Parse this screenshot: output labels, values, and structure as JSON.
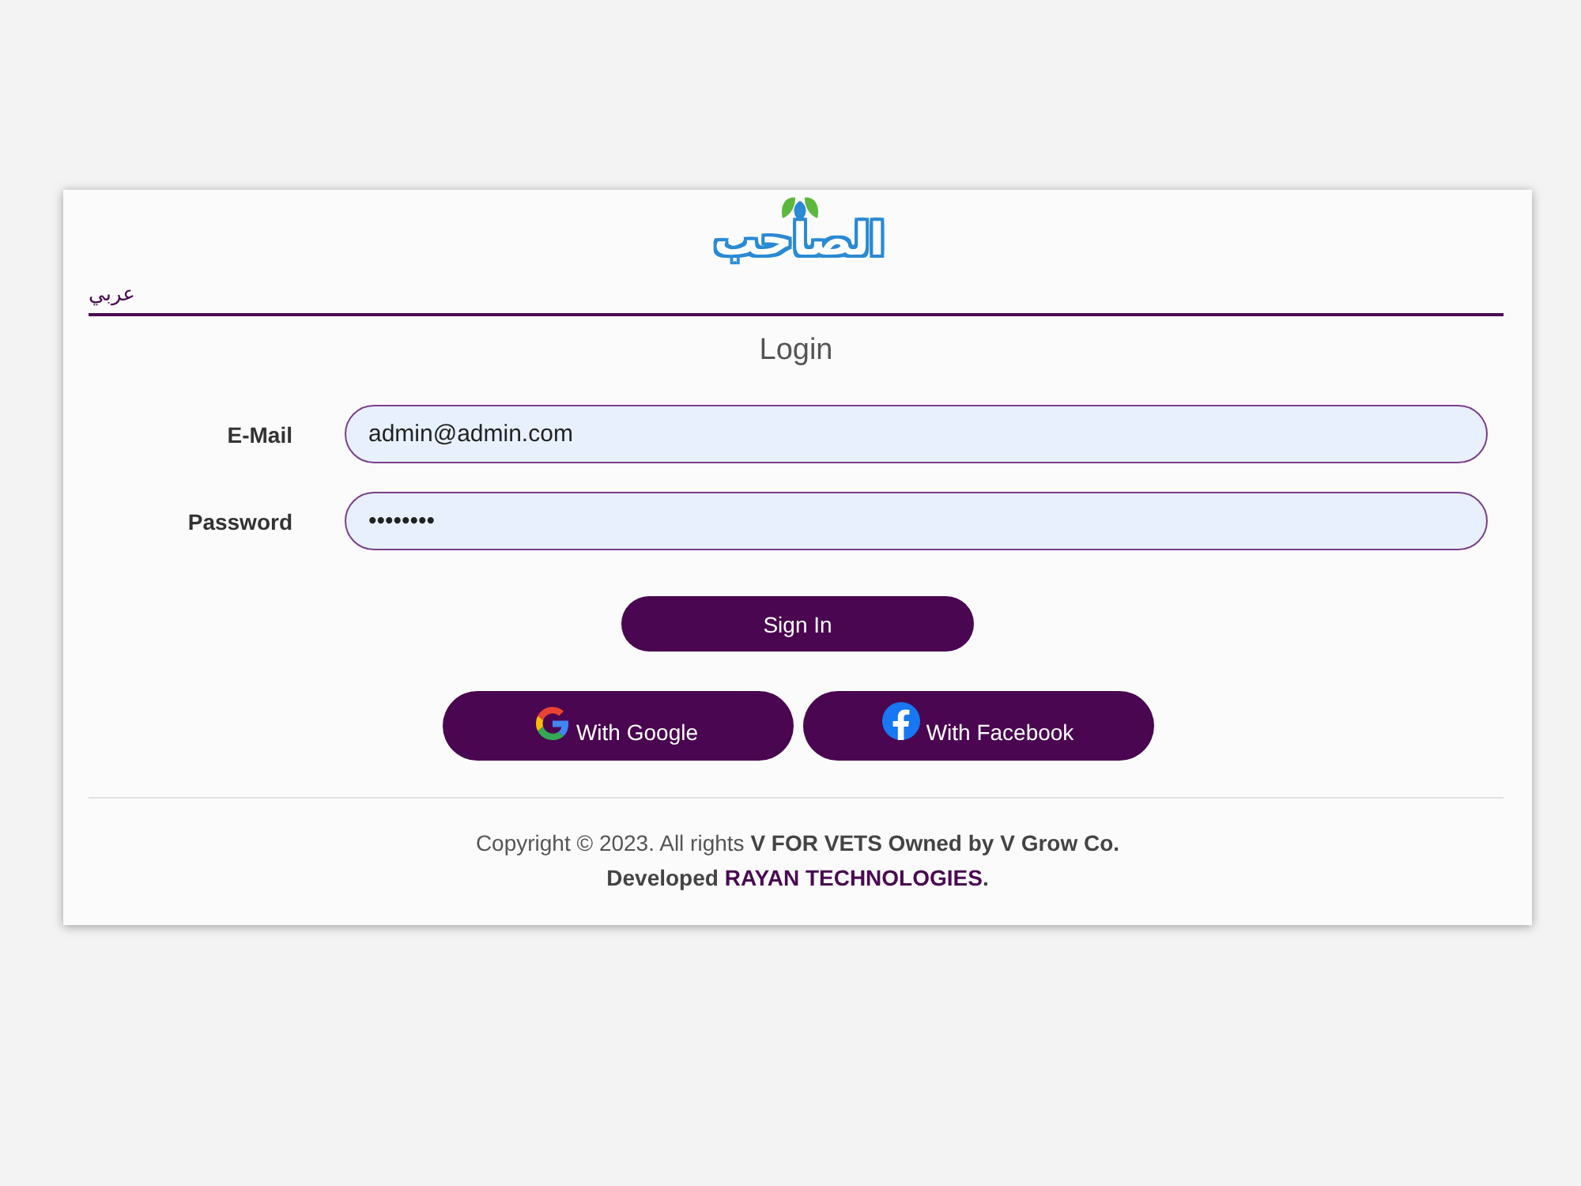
{
  "logo": {
    "text": "الصاحب"
  },
  "language_link": "عربي",
  "title": "Login",
  "fields": [
    {
      "label": "E-Mail",
      "value": "admin@admin.com"
    },
    {
      "label": "Password",
      "value": "••••••••"
    }
  ],
  "sign_in_button": "Sign In",
  "social_buttons": [
    {
      "kind": "google",
      "label": "With Google"
    },
    {
      "kind": "facebook",
      "label": "With Facebook"
    }
  ],
  "footer": {
    "copyright": "Copyright © 2023. All rights **V FOR VETS Owned by V Grow Co.**",
    "developed_prefix": "Developed",
    "developer_link": "RAYAN TECHNOLOGIES",
    "developed_suffix": "."
  }
}
